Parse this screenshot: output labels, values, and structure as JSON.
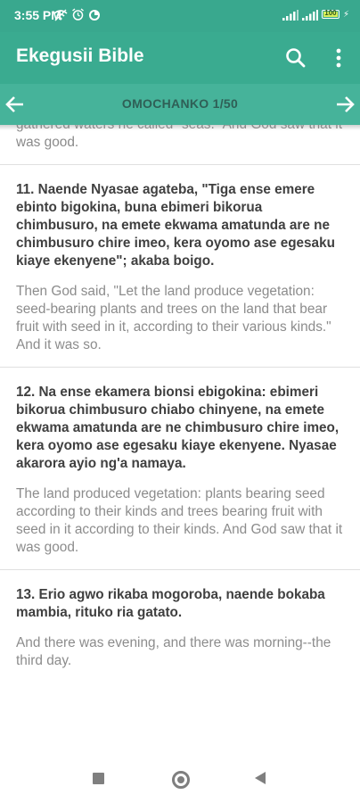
{
  "status_bar": {
    "time": "3:55 PM",
    "battery": "100",
    "icons": [
      "wifi-off-icon",
      "alarm-icon",
      "app-notification-icon"
    ]
  },
  "app_bar": {
    "title": "Ekegusii Bible",
    "icons": [
      "search-icon",
      "overflow-menu-icon"
    ]
  },
  "chapter_nav": {
    "title": "OMOCHANKO 1/50",
    "icons": [
      "arrow-left-icon",
      "arrow-right-icon"
    ]
  },
  "top_fragment": "gathered waters he called \"seas.\" And God saw that it was good.",
  "verses": [
    {
      "ekegusii": "11. Naende Nyasae agateba, \"Tiga ense emere ebinto bigokina, buna ebimeri bikorua chimbusuro, na emete ekwama amatunda are ne chimbusuro chire imeo, kera oyomo ase egesaku kiaye ekenyene\"; akaba boigo.",
      "english": "Then God said, \"Let the land produce vegetation: seed-bearing plants and trees on the land that bear fruit with seed in it, according to their various kinds.\" And it was so."
    },
    {
      "ekegusii": "12. Na ense ekamera bionsi ebigokina: ebimeri bikorua chimbusuro chiabo chinyene, na emete ekwama amatunda are ne chimbusuro chire imeo, kera oyomo ase egesaku kiaye ekenyene. Nyasae akarora ayio ng'a namaya.",
      "english": "The land produced vegetation: plants bearing seed according to their kinds and trees bearing fruit with seed in it according to their kinds. And God saw that it was good."
    },
    {
      "ekegusii": "13. Erio agwo rikaba mogoroba, naende bokaba mambia, rituko ria gatato.",
      "english": "And there was evening, and there was morning--the third day."
    }
  ],
  "system_nav": {
    "icons": [
      "recent-apps-icon",
      "home-icon",
      "back-icon"
    ]
  },
  "colors": {
    "status_bar": "#39a88e",
    "app_bar": "#3aab90",
    "chapter_bar": "#46b39a",
    "chapter_title": "#2f5f56"
  }
}
